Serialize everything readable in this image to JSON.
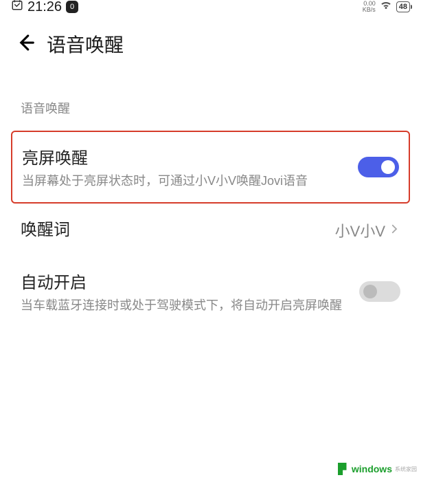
{
  "status": {
    "time": "21:26",
    "speed_top": "0.00",
    "speed_unit": "KB/s",
    "battery": "48"
  },
  "header": {
    "title": "语音唤醒"
  },
  "section_label": "语音唤醒",
  "settings": {
    "screen_wake": {
      "title": "亮屏唤醒",
      "desc": "当屏幕处于亮屏状态时，可通过小V小V唤醒Jovi语音",
      "on": true
    },
    "wake_word": {
      "title": "唤醒词",
      "value": "小V小V"
    },
    "auto_on": {
      "title": "自动开启",
      "desc": "当车载蓝牙连接时或处于驾驶模式下，将自动开启亮屏唤醒",
      "on": false
    }
  },
  "watermark": {
    "brand": "windows",
    "sub": "系统家园"
  }
}
